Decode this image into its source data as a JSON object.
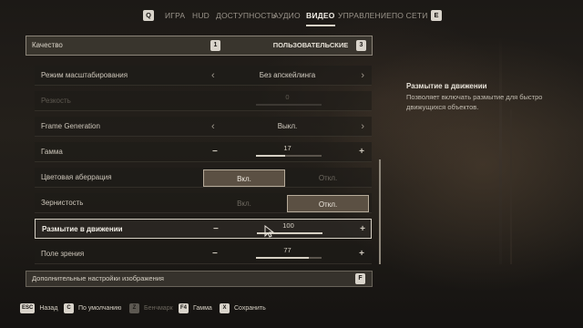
{
  "top_tabs": {
    "prev_key": "Q",
    "next_key": "E",
    "items": [
      {
        "label": "ИГРА"
      },
      {
        "label": "HUD"
      },
      {
        "label": "ДОСТУПНОСТЬ"
      },
      {
        "label": "АУДИО"
      },
      {
        "label": "ВИДЕО",
        "active": true
      },
      {
        "label": "УПРАВЛЕНИЕ"
      },
      {
        "label": "ПО СЕТИ"
      }
    ]
  },
  "quality": {
    "label": "Качество",
    "value": "ПОЛЬЗОВАТЕЛЬСКИЕ",
    "key_left": "1",
    "key_right": "3"
  },
  "settings": {
    "scaling_mode": {
      "label": "Режим масштабирования",
      "value": "Без апскейлинга"
    },
    "sharpness": {
      "label": "Резкость",
      "value": "0",
      "fraction": 0
    },
    "frame_generation": {
      "label": "Frame Generation",
      "value": "Выкл."
    },
    "gamma": {
      "label": "Гамма",
      "value": "17",
      "fraction": 0.45
    },
    "chromatic_aberration": {
      "label": "Цветовая аберрация",
      "on_label": "Вкл.",
      "off_label": "Откл.",
      "selected": "on"
    },
    "film_grain": {
      "label": "Зернистость",
      "on_label": "Вкл.",
      "off_label": "Откл.",
      "selected": "off"
    },
    "motion_blur": {
      "label": "Размытие в движении",
      "value": "100",
      "fraction": 1.0
    },
    "field_of_view": {
      "label": "Поле зрения",
      "value": "77",
      "fraction": 0.8
    }
  },
  "advanced": {
    "label": "Дополнительные настройки изображения",
    "key": "F"
  },
  "description": {
    "title": "Размытие в движении",
    "text": "Позволяет включать размытие для быстро движущихся объектов."
  },
  "bottom_hints": [
    {
      "key": "ESC",
      "label": "Назад",
      "enabled": true
    },
    {
      "key": "C",
      "label": "По умолчанию",
      "enabled": true
    },
    {
      "key": "Z",
      "label": "Бенчмарк",
      "enabled": false
    },
    {
      "key": "F4",
      "label": "Гамма",
      "enabled": true
    },
    {
      "key": "X",
      "label": "Сохранить",
      "enabled": true
    }
  ],
  "colors": {
    "accent": "#d6d0c4",
    "toggle_on": "#625648"
  }
}
